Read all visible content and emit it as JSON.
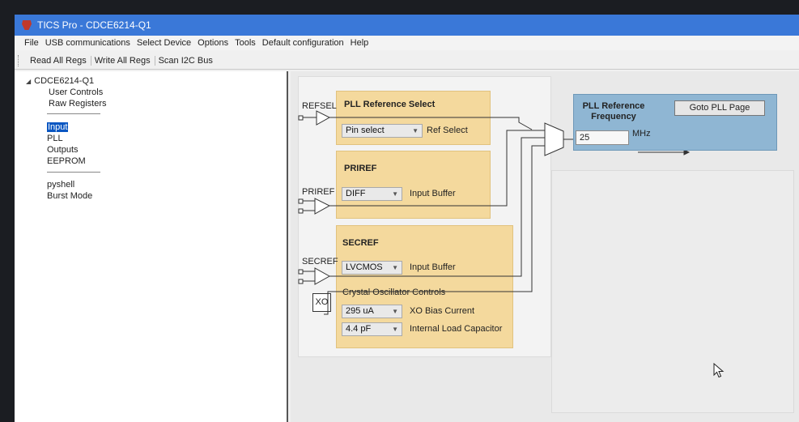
{
  "window": {
    "title": "TICS Pro - CDCE6214-Q1"
  },
  "menu": [
    "File",
    "USB communications",
    "Select Device",
    "Options",
    "Tools",
    "Default configuration",
    "Help"
  ],
  "toolbar": [
    "Read All Regs",
    "Write All Regs",
    "Scan I2C Bus"
  ],
  "tree": {
    "root": "CDCE6214-Q1",
    "group1": [
      "User Controls",
      "Raw Registers"
    ],
    "group2": [
      "Input",
      "PLL",
      "Outputs",
      "EEPROM"
    ],
    "group3": [
      "pyshell",
      "Burst Mode"
    ],
    "selected": "Input"
  },
  "pll_ref_select": {
    "title": "PLL Reference Select",
    "pin_label": "REFSEL",
    "combo_value": "Pin select",
    "combo_label": "Ref Select"
  },
  "priref": {
    "title": "PRIREF",
    "pin_label": "PRIREF",
    "combo_value": "DIFF",
    "combo_label": "Input Buffer"
  },
  "secref": {
    "title": "SECREF",
    "pin_label": "SECREF",
    "combo_value": "LVCMOS",
    "combo_label": "Input Buffer"
  },
  "xo": {
    "title": "Crystal Oscillator Controls",
    "box_label": "XO",
    "bias_value": "295 uA",
    "bias_label": "XO Bias Current",
    "cap_value": "4.4 pF",
    "cap_label": "Internal Load Capacitor"
  },
  "pll_ref_freq": {
    "title": "PLL Reference Frequency",
    "value": "25",
    "unit": "MHz",
    "goto_button": "Goto PLL Page"
  },
  "colors": {
    "titlebar": "#3a78d8",
    "panel": "#f4d99d",
    "freq_panel": "#8fb6d3",
    "selection": "#0a57c2"
  }
}
